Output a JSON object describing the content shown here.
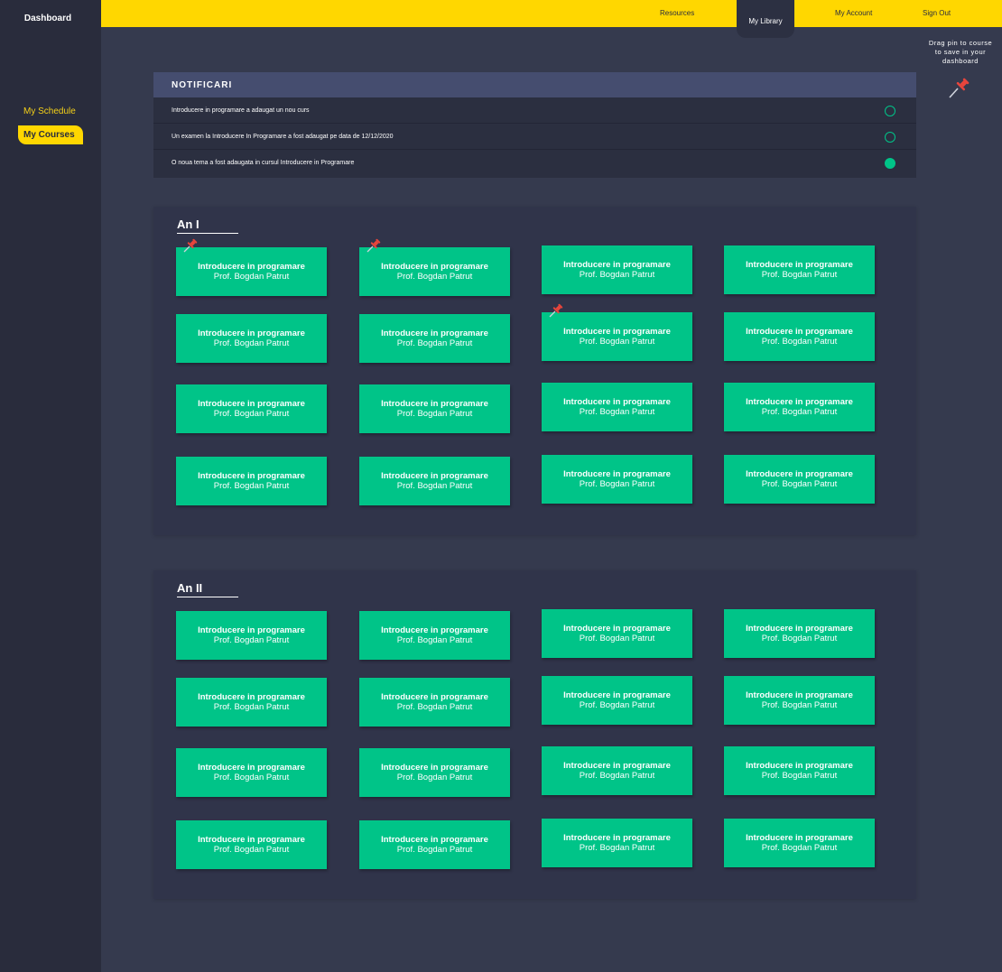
{
  "sidebar": {
    "brand": "Dashboard",
    "items": [
      {
        "label": "My Schedule"
      },
      {
        "label": "My Courses"
      }
    ]
  },
  "topnav": {
    "resources": "Resources",
    "library": "My Library",
    "account": "My Account",
    "signout": "Sign Out"
  },
  "hint": {
    "text": "Drag pin to course to save in your dashboard",
    "pin_icon": "pushpin-icon"
  },
  "notifications": {
    "title": "NOTIFICARI",
    "items": [
      {
        "text": "Introducere in programare a adaugat un nou curs",
        "read": false
      },
      {
        "text": "Un examen la Introducere In Programare a fost adaugat pe data de 12/12/2020",
        "read": false
      },
      {
        "text": "O noua tema a fost adaugata in cursul Introducere in Programare",
        "read": true
      }
    ]
  },
  "years": [
    {
      "title": "An I",
      "course_name": "Introducere in programare",
      "course_prof": "Prof. Bogdan Patrut",
      "pinned": [
        0,
        1,
        6
      ]
    },
    {
      "title": "An II",
      "course_name": "Introducere in programare",
      "course_prof": "Prof. Bogdan Patrut",
      "pinned": []
    }
  ],
  "colors": {
    "accent": "#ffd700",
    "course": "#00c488",
    "pin": "#e8453c"
  }
}
